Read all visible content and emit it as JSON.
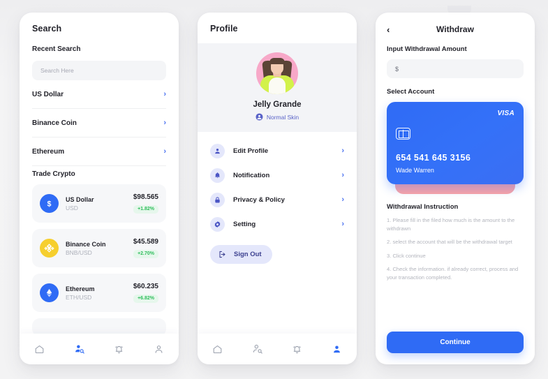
{
  "theme": {
    "accent_blue": "#2f6bf5",
    "chevron_blue": "#4b72f0",
    "icon_bg_lavender": "#e4e7fb",
    "positive_green": "#2fbd5c",
    "positive_bg": "#e6f7ec",
    "card_blue": "#3471f8",
    "card_behind_pink": "#f9a3a7",
    "avatar_bg_pink": "#f7a8c8",
    "muted_text": "#b3b5bd",
    "page_bg": "#f2f2f3"
  },
  "search_screen": {
    "title": "Search",
    "recent_label": "Recent Search",
    "search_input": {
      "value": "",
      "placeholder": "Search Here"
    },
    "recent_items": [
      {
        "label": "US Dollar"
      },
      {
        "label": "Binance Coin"
      },
      {
        "label": "Ethereum"
      }
    ],
    "trade_label": "Trade Crypto",
    "coins": [
      {
        "name": "US Dollar",
        "pair": "USD",
        "price": "$98.565",
        "delta": "+1.82%",
        "icon": "dollar-coin-icon",
        "icon_bg": "#2f6bf5"
      },
      {
        "name": "Binance Coin",
        "pair": "BNB/USD",
        "price": "$45.589",
        "delta": "+2.70%",
        "icon": "binance-coin-icon",
        "icon_bg": "#f6cf2e"
      },
      {
        "name": "Ethereum",
        "pair": "ETH/USD",
        "price": "$60.235",
        "delta": "+6.82%",
        "icon": "ethereum-coin-icon",
        "icon_bg": "#2f6bf5"
      }
    ],
    "nav": [
      {
        "icon": "home-icon",
        "active": false
      },
      {
        "icon": "person-search-icon",
        "active": true
      },
      {
        "icon": "bell-icon",
        "active": false
      },
      {
        "icon": "person-icon",
        "active": false
      }
    ]
  },
  "profile_screen": {
    "title": "Profile",
    "avatar": "user-avatar",
    "name": "Jelly Grande",
    "badge_text": "Normal Skin",
    "badge_icon": "person-circle-icon",
    "menu": [
      {
        "label": "Edit Profile",
        "icon": "person-icon"
      },
      {
        "label": "Notification",
        "icon": "bell-icon"
      },
      {
        "label": "Privacy & Policy",
        "icon": "lock-icon"
      },
      {
        "label": "Setting",
        "icon": "gear-icon"
      }
    ],
    "sign_out": {
      "label": "Sign Out",
      "icon": "logout-icon"
    },
    "nav": [
      {
        "icon": "home-icon",
        "active": false
      },
      {
        "icon": "person-search-icon",
        "active": false
      },
      {
        "icon": "bell-icon",
        "active": false
      },
      {
        "icon": "person-icon",
        "active": true
      }
    ]
  },
  "withdraw_screen": {
    "back_icon": "chevron-left-icon",
    "title": "Withdraw",
    "amount_label": "Input Withdrawal Amount",
    "amount_input": {
      "value": "$",
      "placeholder": "$"
    },
    "select_account_label": "Select Account",
    "card": {
      "brand": "VISA",
      "chip_icon": "card-chip-icon",
      "number": "654 541 645 3156",
      "holder": "Wade Warren"
    },
    "instruction_title": "Withdrawal Instruction",
    "instructions": [
      "1. Please fill in the filed how much is the amount to the withdrawn",
      "2. select the account that will be the withdrawal target",
      "3. Click continue",
      "4. Check the information. if already correct, process and your transaction completed."
    ],
    "continue_label": "Continue"
  }
}
